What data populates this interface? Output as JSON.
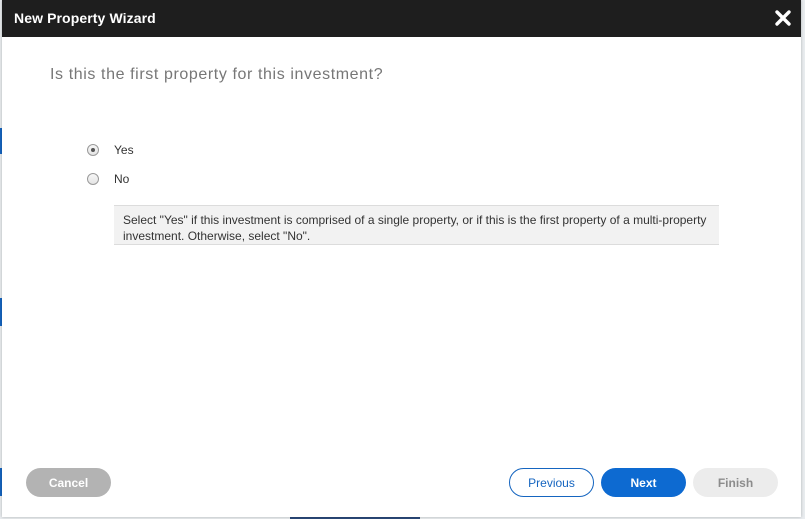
{
  "dialog": {
    "title": "New Property Wizard",
    "close_icon": "close-icon"
  },
  "question": "Is this the first property for this investment?",
  "options": [
    {
      "label": "Yes",
      "selected": true
    },
    {
      "label": "No",
      "selected": false
    }
  ],
  "hint": "Select \"Yes\" if this investment is comprised of a single property, or if this is the first property of a multi-property investment. Otherwise, select \"No\".",
  "buttons": {
    "cancel": "Cancel",
    "previous": "Previous",
    "next": "Next",
    "finish": "Finish"
  },
  "colors": {
    "header": "#1e1e1e",
    "primary": "#0d6ad1",
    "disabled": "#b3b3b3"
  }
}
